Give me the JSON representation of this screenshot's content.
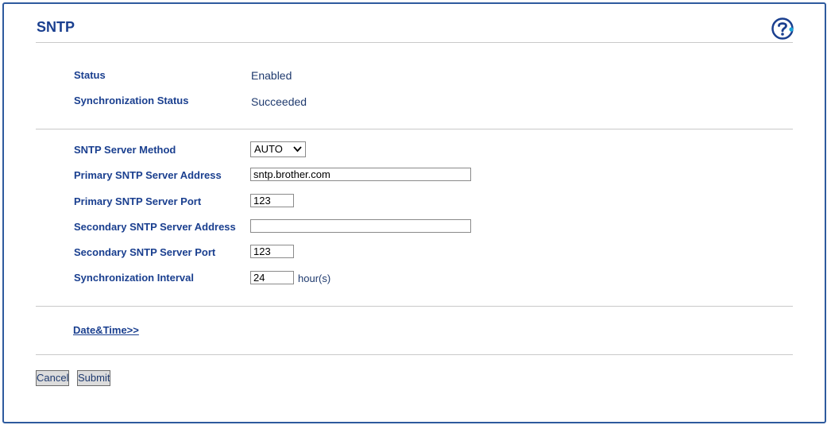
{
  "page": {
    "title": "SNTP",
    "help_icon": "help-question-icon"
  },
  "status": {
    "status_label": "Status",
    "status_value": "Enabled",
    "sync_status_label": "Synchronization Status",
    "sync_status_value": "Succeeded"
  },
  "form": {
    "server_method_label": "SNTP Server Method",
    "server_method_value": "AUTO",
    "primary_address_label": "Primary SNTP Server Address",
    "primary_address_value": "sntp.brother.com",
    "primary_port_label": "Primary SNTP Server Port",
    "primary_port_value": "123",
    "secondary_address_label": "Secondary SNTP Server Address",
    "secondary_address_value": "",
    "secondary_port_label": "Secondary SNTP Server Port",
    "secondary_port_value": "123",
    "interval_label": "Synchronization Interval",
    "interval_value": "24",
    "interval_unit": "hour(s)"
  },
  "links": {
    "date_time": "Date&Time>>"
  },
  "buttons": {
    "cancel": "Cancel",
    "submit": "Submit"
  },
  "colors": {
    "accent": "#1a3f8f",
    "frame": "#2e5a9e"
  }
}
